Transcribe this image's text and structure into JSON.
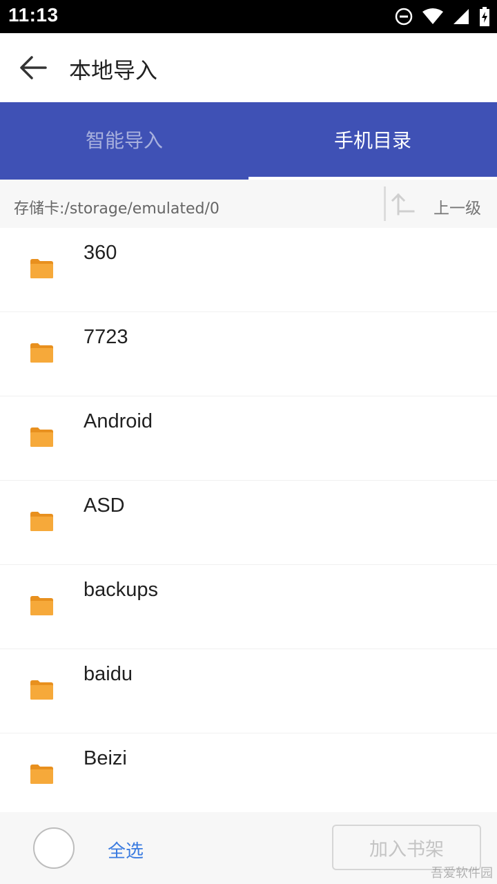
{
  "status_bar": {
    "time": "11:13"
  },
  "app_bar": {
    "title": "本地导入"
  },
  "tabs": [
    {
      "label": "智能导入",
      "active": false
    },
    {
      "label": "手机目录",
      "active": true
    }
  ],
  "path_bar": {
    "path": "存储卡:/storage/emulated/0",
    "up_label": "上一级"
  },
  "folders": [
    {
      "name": "360"
    },
    {
      "name": "7723"
    },
    {
      "name": "Android"
    },
    {
      "name": "ASD"
    },
    {
      "name": "backups"
    },
    {
      "name": "baidu"
    },
    {
      "name": "Beizi"
    }
  ],
  "bottom_bar": {
    "select_all": "全选",
    "add_to_shelf": "加入书架"
  },
  "watermark": "吾爱软件园",
  "colors": {
    "accent": "#3f51b5",
    "folder": "#f0a030",
    "link": "#3a7be0"
  }
}
